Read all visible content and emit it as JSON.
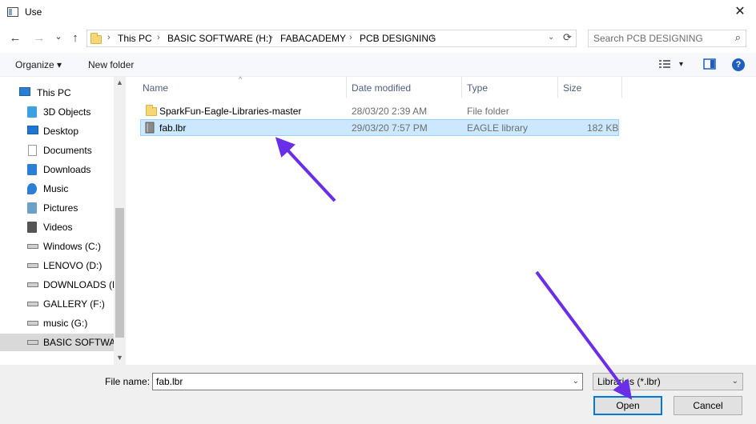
{
  "window": {
    "title": "Use",
    "close_glyph": "✕"
  },
  "nav": {
    "back_glyph": "←",
    "forward_glyph": "→",
    "history_glyph": "⌄",
    "up_glyph": "↑",
    "breadcrumb": [
      "This PC",
      "BASIC SOFTWARE (H:)",
      "FABACADEMY",
      "PCB DESIGNING"
    ],
    "separator": "›",
    "dropdown_glyph": "⌄",
    "refresh_glyph": "⟳"
  },
  "search": {
    "placeholder": "Search PCB DESIGNING",
    "icon": "search-icon",
    "glyph": "⌕"
  },
  "toolbar": {
    "organize_label": "Organize ▾",
    "new_folder_label": "New folder",
    "view_dropdown_glyph": "▾",
    "help_glyph": "?"
  },
  "sidebar": {
    "items": [
      {
        "label": "This PC",
        "icon": "pc-icon"
      },
      {
        "label": "3D Objects",
        "icon": "cube-icon"
      },
      {
        "label": "Desktop",
        "icon": "desktop-icon"
      },
      {
        "label": "Documents",
        "icon": "document-icon"
      },
      {
        "label": "Downloads",
        "icon": "download-icon"
      },
      {
        "label": "Music",
        "icon": "music-icon"
      },
      {
        "label": "Pictures",
        "icon": "picture-icon"
      },
      {
        "label": "Videos",
        "icon": "video-icon"
      },
      {
        "label": "Windows (C:)",
        "icon": "drive-icon"
      },
      {
        "label": "LENOVO (D:)",
        "icon": "drive-icon"
      },
      {
        "label": "DOWNLOADS (E",
        "icon": "drive-icon"
      },
      {
        "label": "GALLERY (F:)",
        "icon": "drive-icon"
      },
      {
        "label": "music (G:)",
        "icon": "drive-icon"
      },
      {
        "label": "BASIC SOFTWAR",
        "icon": "drive-icon"
      }
    ],
    "selected_index": 13,
    "scroll_up_glyph": "▲",
    "scroll_down_glyph": "▼"
  },
  "filelist": {
    "columns": [
      "Name",
      "Date modified",
      "Type",
      "Size"
    ],
    "sort_glyph": "^",
    "rows": [
      {
        "name": "SparkFun-Eagle-Libraries-master",
        "date": "28/03/20 2:39 AM",
        "type": "File folder",
        "size": "",
        "icon": "folder-icon",
        "selected": false
      },
      {
        "name": "fab.lbr",
        "date": "29/03/20 7:57 PM",
        "type": "EAGLE library",
        "size": "182 KB",
        "icon": "file-icon",
        "selected": true
      }
    ]
  },
  "bottom": {
    "file_name_label": "File name:",
    "file_name_value": "fab.lbr",
    "dropdown_glyph": "⌄",
    "filter_value": "Libraries (*.lbr)",
    "open_label": "Open",
    "cancel_label": "Cancel"
  },
  "colors": {
    "accent": "#0078d7",
    "selection": "#cce8ff",
    "annotation_arrow": "#6a2ee8"
  }
}
